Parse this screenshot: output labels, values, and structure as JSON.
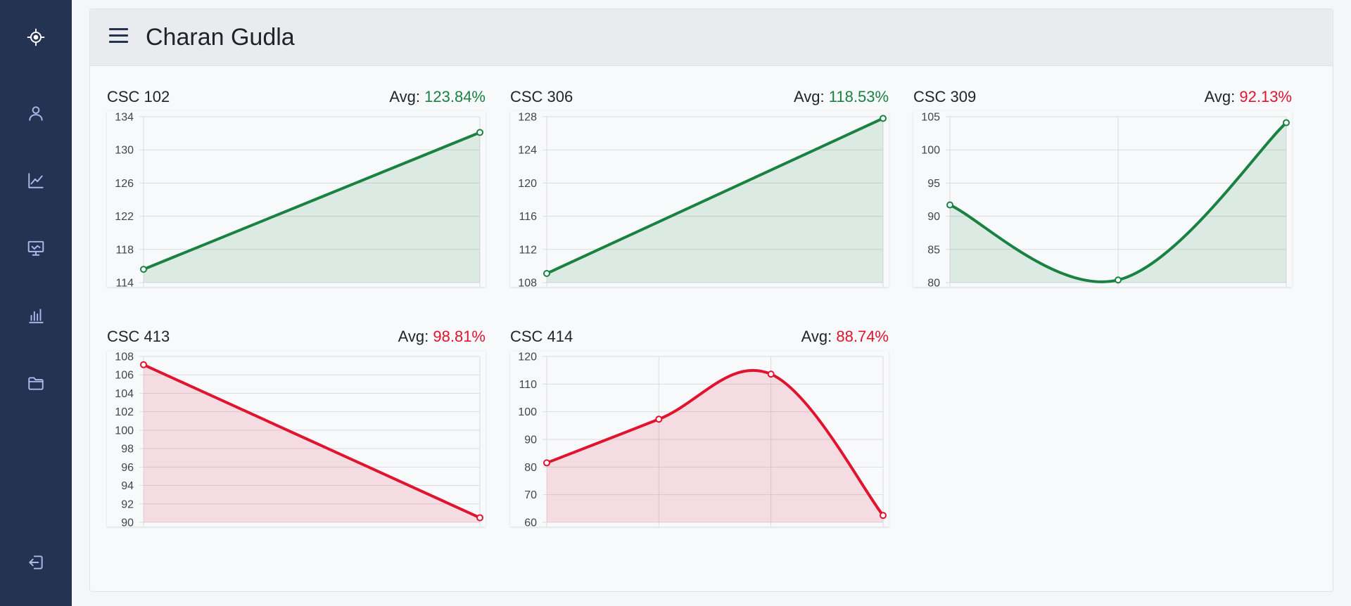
{
  "header": {
    "title": "Charan Gudla"
  },
  "sidebar": {
    "items": [
      {
        "icon": "crosshair-logo-icon"
      },
      {
        "icon": "user-icon"
      },
      {
        "icon": "line-chart-icon"
      },
      {
        "icon": "presentation-icon"
      },
      {
        "icon": "bar-chart-icon"
      },
      {
        "icon": "folder-icon"
      },
      {
        "icon": "logout-icon"
      }
    ]
  },
  "colors": {
    "good": "#198241",
    "bad": "#e0142e",
    "sidebar": "#253352"
  },
  "charts": [
    {
      "course": "CSC 102",
      "avg_label": "Avg:",
      "avg_value": "123.84%",
      "status": "good"
    },
    {
      "course": "CSC 306",
      "avg_label": "Avg:",
      "avg_value": "118.53%",
      "status": "good"
    },
    {
      "course": "CSC 309",
      "avg_label": "Avg:",
      "avg_value": "92.13%",
      "status": "bad"
    },
    {
      "course": "CSC 413",
      "avg_label": "Avg:",
      "avg_value": "98.81%",
      "status": "bad"
    },
    {
      "course": "CSC 414",
      "avg_label": "Avg:",
      "avg_value": "88.74%",
      "status": "bad"
    }
  ],
  "chart_data": [
    {
      "type": "area",
      "title": "CSC 102",
      "values": [
        115.6,
        132.1
      ],
      "ylim": [
        114,
        134
      ],
      "yticks": [
        114,
        118,
        122,
        126,
        130,
        134
      ],
      "color": "#198241",
      "grid": true
    },
    {
      "type": "area",
      "title": "CSC 306",
      "values": [
        109.1,
        127.8
      ],
      "ylim": [
        108,
        128
      ],
      "yticks": [
        108,
        112,
        116,
        120,
        124,
        128
      ],
      "color": "#198241",
      "grid": true
    },
    {
      "type": "area",
      "title": "CSC 309",
      "values": [
        91.7,
        80.4,
        104.1
      ],
      "ylim": [
        80,
        105
      ],
      "yticks": [
        80,
        85,
        90,
        95,
        100,
        105
      ],
      "color": "#198241",
      "grid": true
    },
    {
      "type": "area",
      "title": "CSC 413",
      "values": [
        107.1,
        90.5
      ],
      "ylim": [
        90,
        108
      ],
      "yticks": [
        90,
        92,
        94,
        96,
        98,
        100,
        102,
        104,
        106,
        108
      ],
      "color": "#e0142e",
      "grid": true
    },
    {
      "type": "area",
      "title": "CSC 414",
      "values": [
        81.5,
        97.3,
        113.6,
        62.5
      ],
      "ylim": [
        60,
        120
      ],
      "yticks": [
        60,
        70,
        80,
        90,
        100,
        110,
        120
      ],
      "color": "#e0142e",
      "grid": true
    }
  ]
}
